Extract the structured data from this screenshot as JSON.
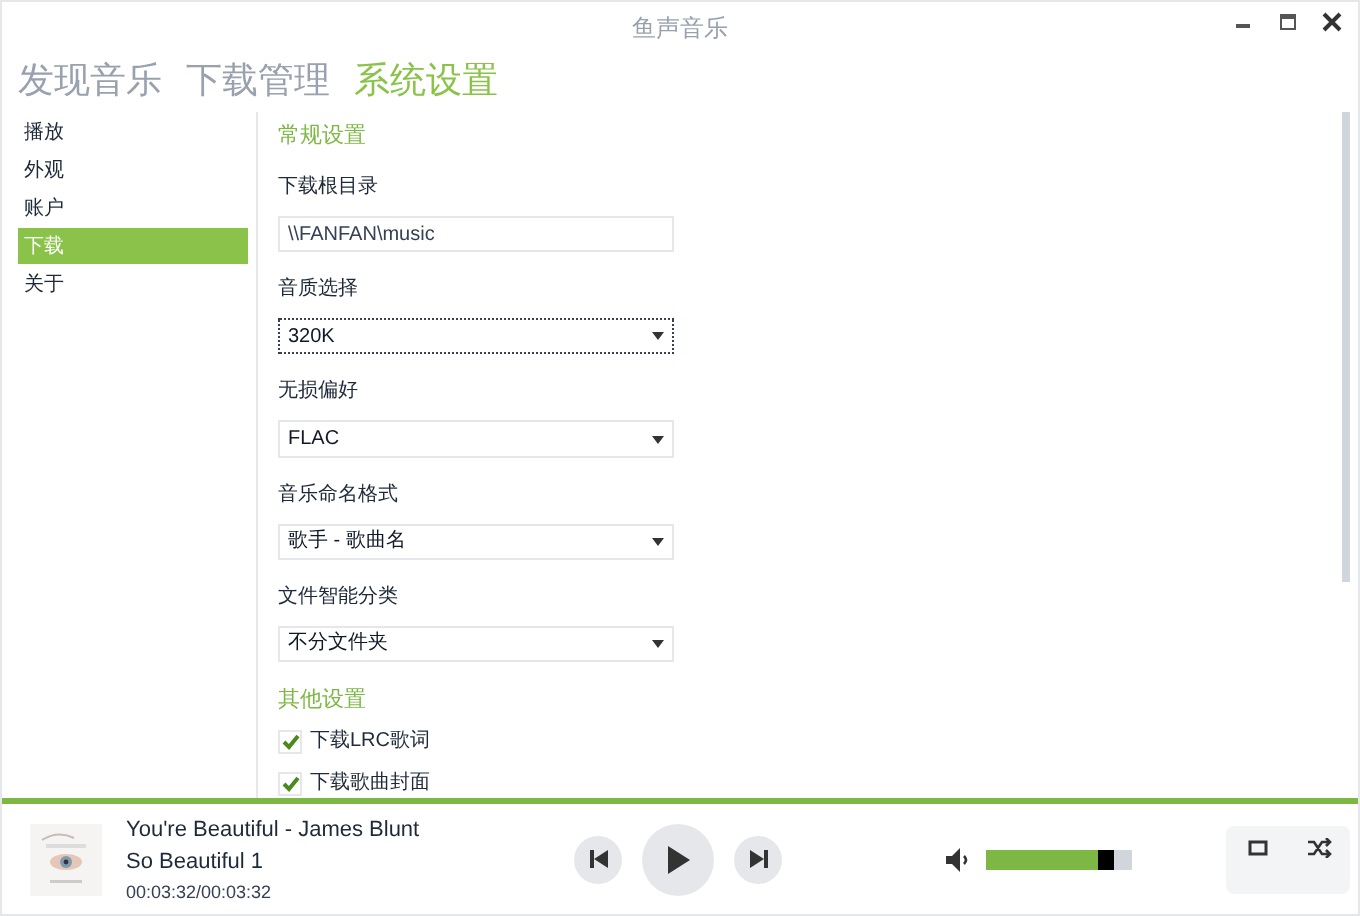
{
  "window": {
    "title": "鱼声音乐"
  },
  "nav_tabs": [
    {
      "label": "发现音乐",
      "selected": false
    },
    {
      "label": "下载管理",
      "selected": false
    },
    {
      "label": "系统设置",
      "selected": true
    }
  ],
  "sidebar": {
    "items": [
      {
        "label": "播放",
        "selected": false
      },
      {
        "label": "外观",
        "selected": false
      },
      {
        "label": "账户",
        "selected": false
      },
      {
        "label": "下载",
        "selected": true
      },
      {
        "label": "关于",
        "selected": false
      }
    ]
  },
  "settings": {
    "general_heading": "常规设置",
    "fields": [
      {
        "kind": "text",
        "label": "下载根目录",
        "value": "\\\\FANFAN\\music",
        "focused": false
      },
      {
        "kind": "dropdown",
        "label": "音质选择",
        "value": "320K",
        "focused": true
      },
      {
        "kind": "dropdown",
        "label": "无损偏好",
        "value": "FLAC",
        "focused": false
      },
      {
        "kind": "dropdown",
        "label": "音乐命名格式",
        "value": "歌手 - 歌曲名",
        "focused": false
      },
      {
        "kind": "dropdown",
        "label": "文件智能分类",
        "value": "不分文件夹",
        "focused": false
      }
    ],
    "other_heading": "其他设置",
    "checkboxes": [
      {
        "label": "下载LRC歌词",
        "checked": true
      },
      {
        "label": "下载歌曲封面",
        "checked": true
      }
    ]
  },
  "player": {
    "progress": {
      "level": 1
    },
    "song": "You're Beautiful - James Blunt",
    "album": "So Beautiful 1",
    "time": "00:03:32/00:03:32",
    "volume": {
      "level": 0.87
    }
  }
}
